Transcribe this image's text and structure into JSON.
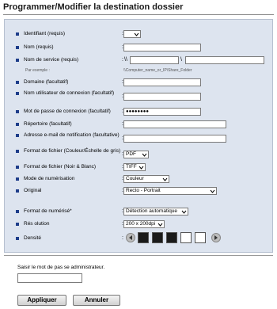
{
  "page": {
    "title": "Programmer/Modifier la destination dossier"
  },
  "form": {
    "identifiant": {
      "label": "Identifiant (requis)",
      "value": ""
    },
    "nom": {
      "label": "Nom (requis)",
      "value": ""
    },
    "service": {
      "label": "Nom de service (requis)",
      "prefix": "\\\\",
      "sep": "\\",
      "example_label": "Par exemple :",
      "example_value": "\\\\Computer_name_or_IP\\Share_Folder"
    },
    "domaine": {
      "label": "Domaine (facultatif)",
      "value": ""
    },
    "utilisateur": {
      "label": "Nom utilisateur de connexion (facultatif)",
      "value": ""
    },
    "motdepasse": {
      "label": "Mot de passe de connexion (facultatif)",
      "value": "●●●●●●●●"
    },
    "repertoire": {
      "label": "Répertoire (facultatif)",
      "value": ""
    },
    "email": {
      "label": "Adresse e-mail de notification (facultative)",
      "value": ""
    },
    "format_couleur": {
      "label": "Format de fichier (Couleur/Échelle de gris)",
      "value": "PDF"
    },
    "format_nb": {
      "label": "Format de fichier (Noir & Blanc)",
      "value": "TIFF"
    },
    "mode_numerisation": {
      "label": "Mode de numérisation",
      "value": "Couleur"
    },
    "original": {
      "label": "Original",
      "value": "Recto - Portrait"
    },
    "format_numerise": {
      "label": "Format de numérisé*",
      "value": "Détection automatique"
    },
    "resolution": {
      "label": "Rés olution",
      "value": "200 x 200dpi"
    },
    "densite": {
      "label": "Densité"
    }
  },
  "densite_levels": [
    {
      "color": "#1a1a1a"
    },
    {
      "color": "#1a1a1a"
    },
    {
      "color": "#1a1a1a"
    },
    {
      "color": "#ffffff"
    },
    {
      "color": "#ffffff"
    }
  ],
  "admin": {
    "label": "Saisir le mot de pas se administrateur.",
    "value": ""
  },
  "buttons": {
    "apply": "Appliquer",
    "cancel": "Annuler"
  },
  "colors": {
    "panel_bg": "#dde4ef",
    "bullet": "#1e3d8a"
  }
}
